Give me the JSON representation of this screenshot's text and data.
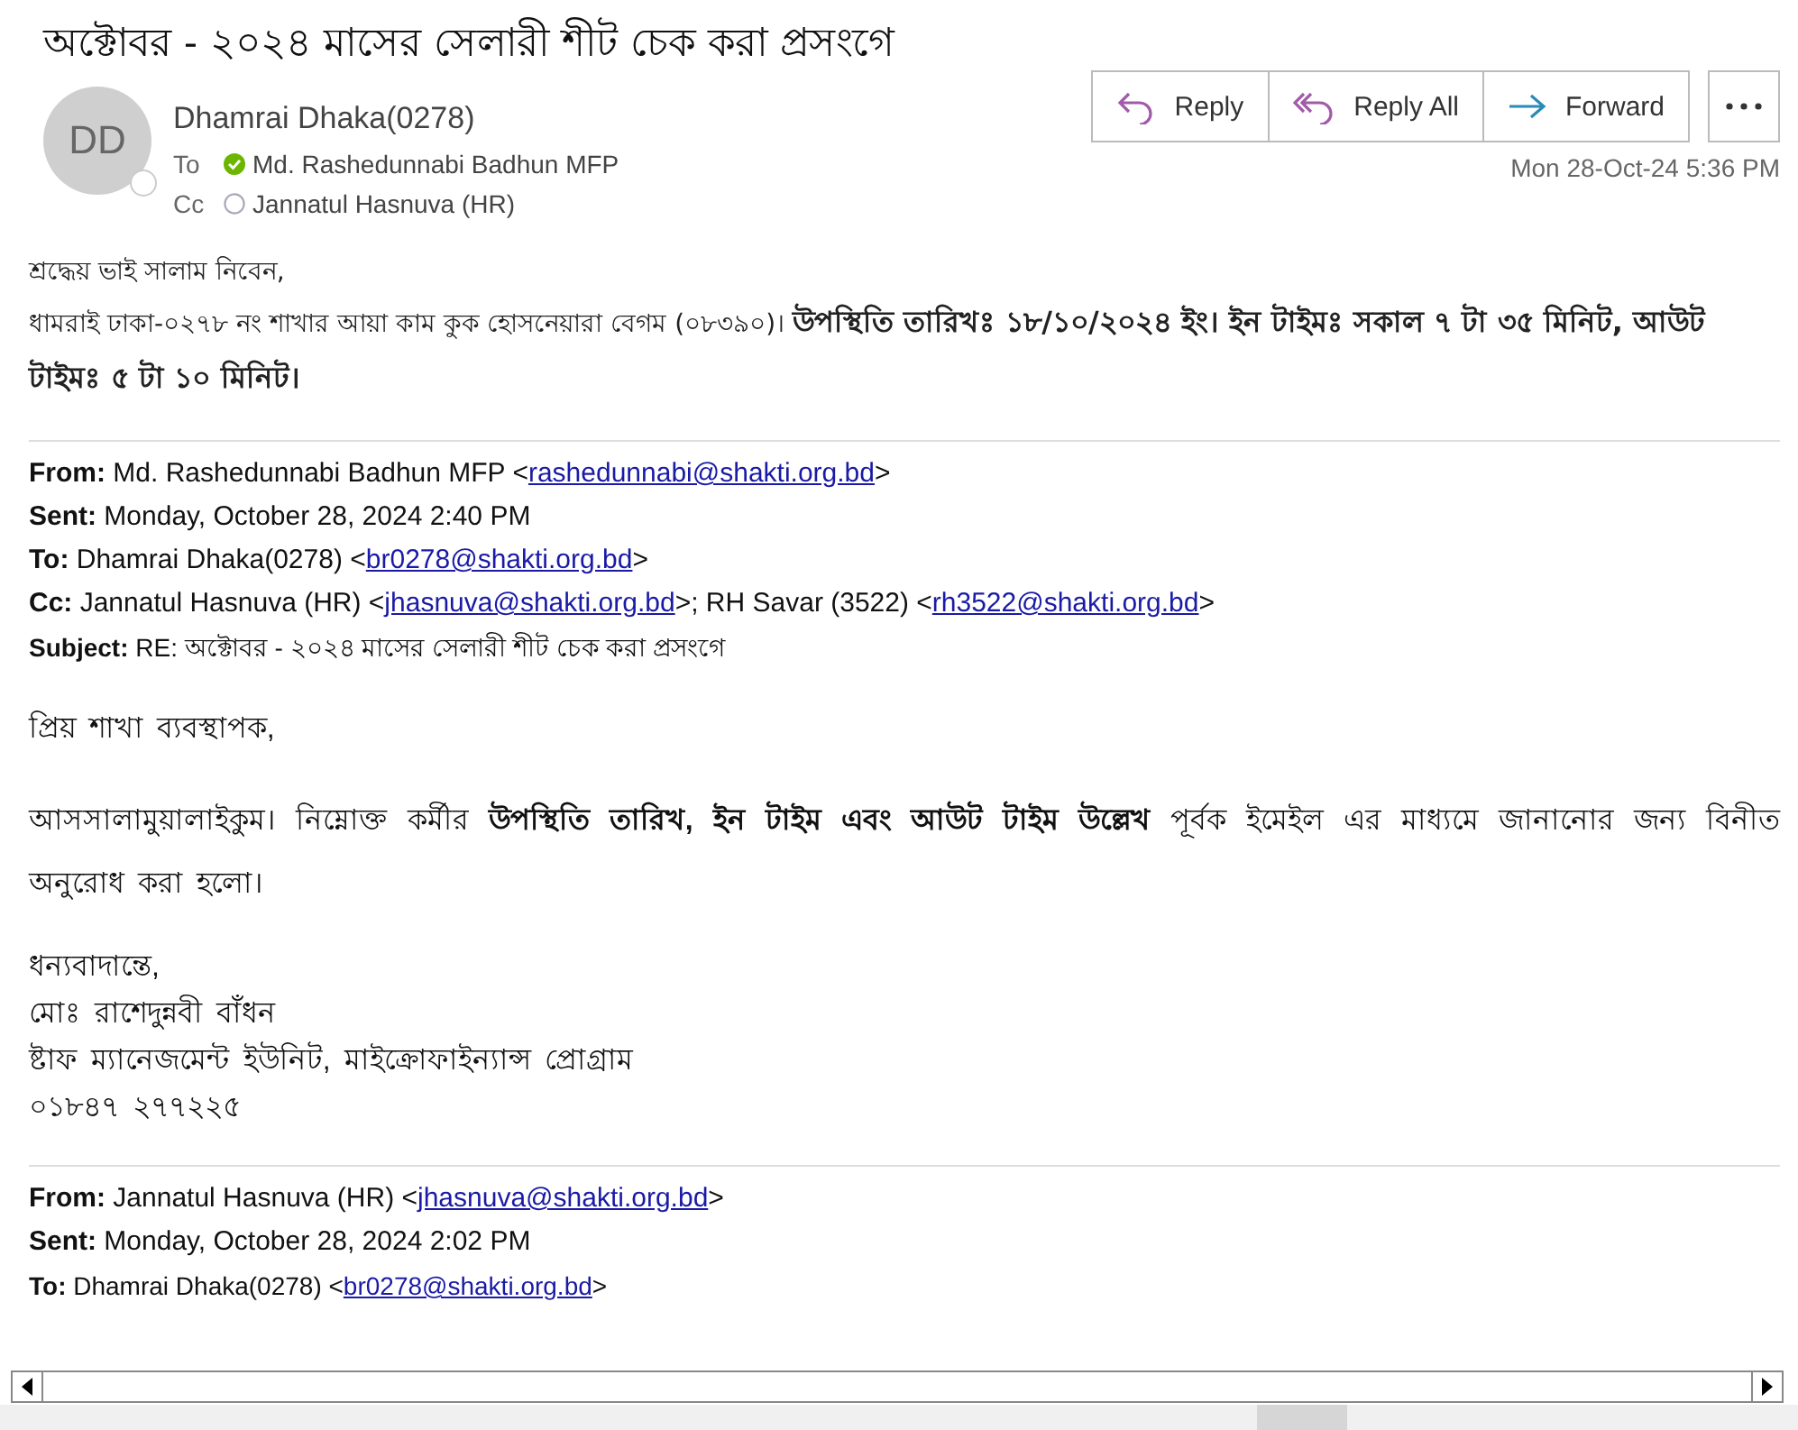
{
  "subject": "অক্টোবর - ২০২৪ মাসের সেলারী শীট চেক করা প্রসংগে",
  "sender": {
    "initials": "DD",
    "name": "Dhamrai Dhaka(0278)",
    "recipients": [
      {
        "label": "To",
        "name": "Md. Rashedunnabi Badhun MFP",
        "available": true
      },
      {
        "label": "Cc",
        "name": "Jannatul Hasnuva (HR)",
        "available": false
      }
    ]
  },
  "actions": [
    {
      "label": "Reply",
      "kind": "reply"
    },
    {
      "label": "Reply All",
      "kind": "reply-all"
    },
    {
      "label": "Forward",
      "kind": "forward"
    }
  ],
  "date": "Mon 28-Oct-24 5:36 PM",
  "body": [
    "শ্রদ্ধেয় ভাই সালাম নিবেন,",
    "ধামরাই ঢাকা-০২৭৮ নং শাখার আয়া কাম কুক হোসনেয়ারা বেগম (০৮৩৯০)। **উপস্থিতি তারিখঃ ১৮/১০/২০২৪ ইং। ইন টাইমঃ সকাল ৭ টা ৩৫ মিনিট, আউট টাইমঃ ৫ টা ১০ মিনিট।**"
  ],
  "quoted": [
    {
      "headers": [
        {
          "label": "From:",
          "parts": [
            {
              "text": "Md. Rashedunnabi Badhun MFP <"
            },
            {
              "link": "rashedunnabi@shakti.org.bd"
            },
            {
              "text": ">"
            }
          ]
        },
        {
          "label": "Sent:",
          "parts": [
            {
              "text": "Monday, October 28, 2024 2:40 PM"
            }
          ]
        },
        {
          "label": "To:",
          "parts": [
            {
              "text": "Dhamrai Dhaka(0278) <"
            },
            {
              "link": "br0278@shakti.org.bd"
            },
            {
              "text": ">"
            }
          ]
        },
        {
          "label": "Cc:",
          "parts": [
            {
              "text": "Jannatul Hasnuva (HR) <"
            },
            {
              "link": "jhasnuva@shakti.org.bd"
            },
            {
              "text": ">; RH Savar (3522) <"
            },
            {
              "link": "rh3522@shakti.org.bd"
            },
            {
              "text": ">"
            }
          ]
        },
        {
          "label": "Subject:",
          "parts": [
            {
              "text": "RE: অক্টোবর - ২০২৪ মাসের সেলারী শীট চেক করা প্রসংগে"
            }
          ]
        }
      ],
      "paragraphs": [
        "প্রিয় শাখা ব্যবস্থাপক,",
        "আসসালামুয়ালাইকুম। নিম্নোক্ত কর্মীর **উপস্থিতি তারিখ, ইন টাইম এবং আউট টাইম উল্লেখ** পূর্বক ইমেইল এর মাধ্যমে জানানোর জন্য বিনীত অনুরোধ করা হলো।"
      ],
      "signature": [
        "ধন্যবাদান্তে,",
        "মোঃ রাশেদুন্নবী বাঁধন",
        "ষ্টাফ ম্যানেজমেন্ট ইউনিট, মাইক্রোফাইন্যান্স প্রোগ্রাম",
        "০১৮৪৭ ২৭৭২২৫"
      ]
    },
    {
      "headers": [
        {
          "label": "From:",
          "parts": [
            {
              "text": "Jannatul Hasnuva (HR) <"
            },
            {
              "link": "jhasnuva@shakti.org.bd"
            },
            {
              "text": ">"
            }
          ]
        },
        {
          "label": "Sent:",
          "parts": [
            {
              "text": "Monday, October 28, 2024 2:02 PM"
            }
          ]
        },
        {
          "label": "To:",
          "parts": [
            {
              "text": "Dhamrai Dhaka(0278) <"
            },
            {
              "link": "br0278@shakti.org.bd"
            },
            {
              "text": ">"
            }
          ]
        }
      ]
    }
  ]
}
